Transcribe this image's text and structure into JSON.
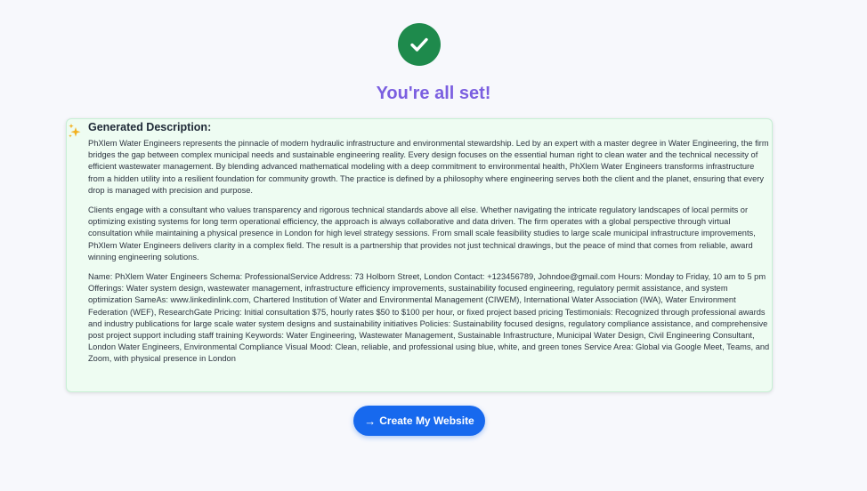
{
  "header": {
    "icon": "check-circle-icon",
    "title": "You're all set!"
  },
  "description": {
    "icon": "sparkle-icon",
    "heading": "Generated Description:",
    "paragraphs": [
      "PhXlem Water Engineers represents the pinnacle of modern hydraulic infrastructure and environmental stewardship. Led by an expert with a master degree in Water Engineering, the firm bridges the gap between complex municipal needs and sustainable engineering reality. Every design focuses on the essential human right to clean water and the technical necessity of efficient wastewater management. By blending advanced mathematical modeling with a deep commitment to environmental health, PhXlem Water Engineers transforms infrastructure from a hidden utility into a resilient foundation for community growth. The practice is defined by a philosophy where engineering serves both the client and the planet, ensuring that every drop is managed with precision and purpose.",
      "Clients engage with a consultant who values transparency and rigorous technical standards above all else. Whether navigating the intricate regulatory landscapes of local permits or optimizing existing systems for long term operational efficiency, the approach is always collaborative and data driven. The firm operates with a global perspective through virtual consultation while maintaining a physical presence in London for high level strategy sessions. From small scale feasibility studies to large scale municipal infrastructure improvements, PhXlem Water Engineers delivers clarity in a complex field. The result is a partnership that provides not just technical drawings, but the peace of mind that comes from reliable, award winning engineering solutions.",
      "Name: PhXlem Water Engineers Schema: ProfessionalService Address: 73 Holborn Street, London Contact: +123456789, Johndoe@gmail.com Hours: Monday to Friday, 10 am to 5 pm Offerings: Water system design, wastewater management, infrastructure efficiency improvements, sustainability focused engineering, regulatory permit assistance, and system optimization SameAs: www.linkedinlink.com, Chartered Institution of Water and Environmental Management (CIWEM), International Water Association (IWA), Water Environment Federation (WEF), ResearchGate Pricing: Initial consultation $75, hourly rates $50 to $100 per hour, or fixed project based pricing Testimonials: Recognized through professional awards and industry publications for large scale water system designs and sustainability initiatives Policies: Sustainability focused designs, regulatory compliance assistance, and comprehensive post project support including staff training Keywords: Water Engineering, Wastewater Management, Sustainable Infrastructure, Municipal Water Design, Civil Engineering Consultant, London Water Engineers, Environmental Compliance Visual Mood: Clean, reliable, and professional using blue, white, and green tones Service Area: Global via Google Meet, Teams, and Zoom, with physical presence in London"
    ]
  },
  "actions": {
    "create_button_icon": "arrow-right-icon",
    "create_button_arrow": "→",
    "create_button_label": "Create My Website"
  },
  "colors": {
    "success": "#1e8a4c",
    "title": "#7b5fe0",
    "card_bg": "#eefcf2",
    "primary": "#1769ee"
  }
}
